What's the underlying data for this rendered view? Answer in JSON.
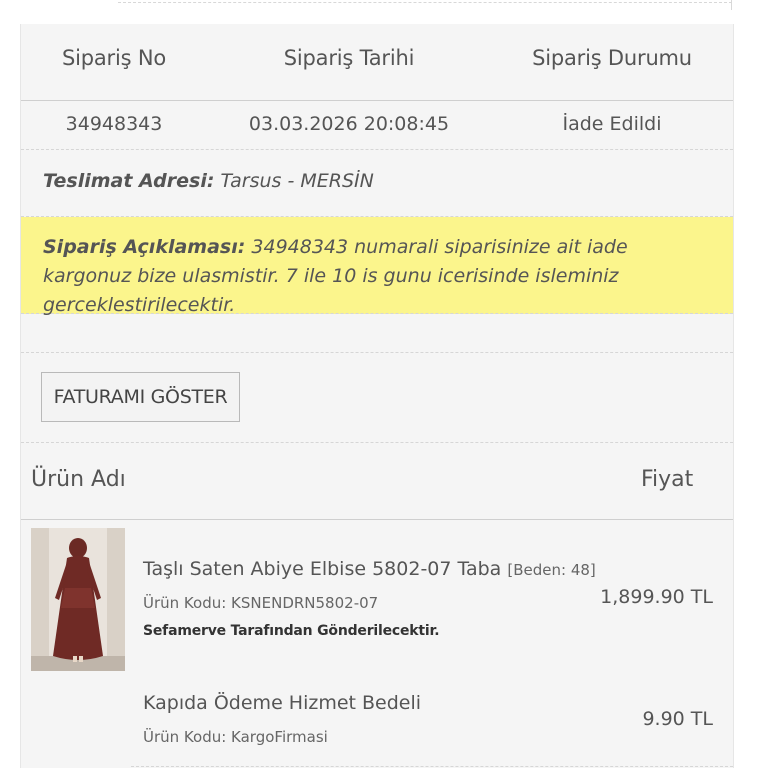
{
  "order_table": {
    "headers": [
      "Sipariş No",
      "Sipariş Tarihi",
      "Sipariş Durumu"
    ],
    "values": [
      "34948343",
      "03.03.2026 20:08:45",
      "İade Edildi"
    ]
  },
  "delivery": {
    "label": "Teslimat Adresi:",
    "value": "Tarsus - MERSİN"
  },
  "order_note": {
    "label": "Sipariş Açıklaması:",
    "text": "34948343 numarali siparisinize ait iade kargonuz bize ulasmistir. 7 ile 10 is gunu icerisinde isleminiz gerceklestirilecektir.",
    "background": "#fbf58c"
  },
  "invoice_button": {
    "label": "FATURAMI GÖSTER"
  },
  "product_table": {
    "header_name": "Ürün Adı",
    "header_price": "Fiyat",
    "items": [
      {
        "title": "Taşlı Saten Abiye Elbise 5802-07 Taba",
        "size": "[Beden: 48]",
        "code": "Ürün Kodu: KSNENDRN5802-07",
        "shipping": "Sefamerve Tarafından Gönderilecektir.",
        "price": "1,899.90 TL",
        "thumbnail": "product-photo-dress"
      },
      {
        "title": "Kapıda Ödeme Hizmet Bedeli",
        "code": "Ürün Kodu: KargoFirmasi",
        "price": "9.90 TL"
      }
    ]
  }
}
